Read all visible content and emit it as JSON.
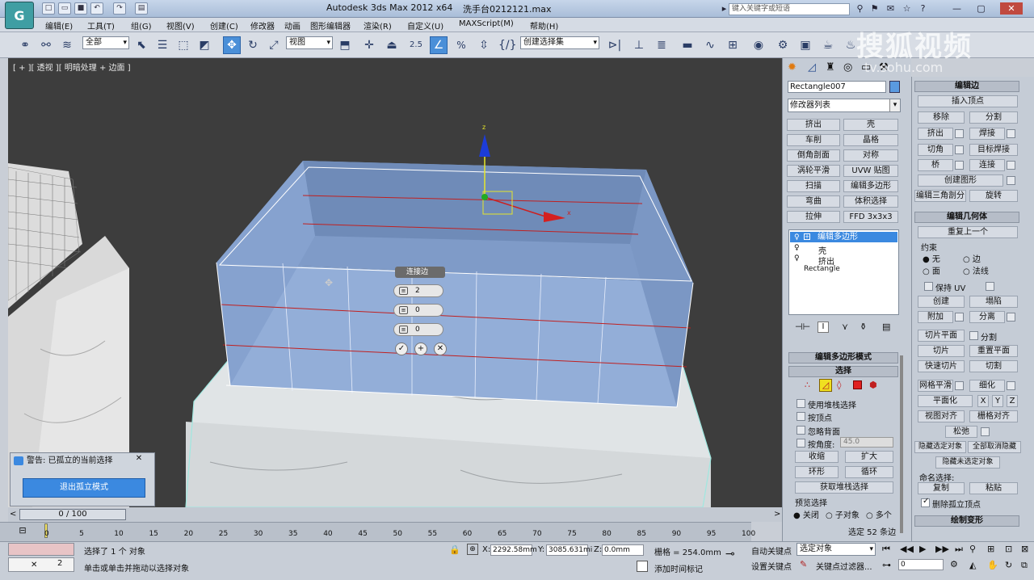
{
  "app": {
    "title": "Autodesk 3ds Max  2012 x64",
    "file": "洗手台0212121.max",
    "icon": "3ds-max-icon"
  },
  "search": {
    "placeholder": "键入关键字或短语"
  },
  "menu": [
    "编辑(E)",
    "工具(T)",
    "组(G)",
    "视图(V)",
    "创建(C)",
    "修改器",
    "动画",
    "图形编辑器",
    "渲染(R)",
    "自定义(U)",
    "MAXScript(M)",
    "帮助(H)"
  ],
  "toolbar": {
    "filter": "全部",
    "refcoord": "视图",
    "selset": "创建选择集",
    "snap": "2.5",
    "angle_snap": "%"
  },
  "viewport": {
    "label": "[ + ][ 透视 ][ 明暗处理 + 边面 ]",
    "axis_z": "z",
    "axis_x": "x"
  },
  "caddy": {
    "title": "连接边",
    "fields": [
      "2",
      "0",
      "0"
    ]
  },
  "isolate": {
    "title": "警告: 已孤立的当前选择",
    "button": "退出孤立模式"
  },
  "timeline": {
    "frame": "0 / 100",
    "ticks": [
      "0",
      "5",
      "10",
      "15",
      "20",
      "25",
      "30",
      "35",
      "40",
      "45",
      "50",
      "55",
      "60",
      "65",
      "70",
      "75",
      "80",
      "85",
      "90",
      "95",
      "100"
    ]
  },
  "status": {
    "selected": "选择了 1 个 对象",
    "hint": "单击或单击并拖动以选择对象",
    "x_label": "X:",
    "x": "2292.58mm",
    "y_label": "Y:",
    "y": "3085.631mi",
    "z_label": "Z:",
    "z": "0.0mm",
    "grid": "栅格 = 254.0mm",
    "autokey": "自动关键点",
    "setkey": "设置关键点",
    "keyfilter": "选定对象",
    "keyfilters": "关键点过滤器...",
    "addtime": "添加时间标记",
    "frame_val": "0",
    "mini_label": "2"
  },
  "cmd": {
    "object_name": "Rectangle007",
    "modlist": "修改器列表",
    "modbuttons": [
      "挤出",
      "壳",
      "车削",
      "晶格",
      "倒角剖面",
      "对称",
      "涡轮平滑",
      "UVW 贴图",
      "扫描",
      "编辑多边形",
      "弯曲",
      "体积选择",
      "拉伸",
      "FFD 3x3x3"
    ],
    "stack": [
      "编辑多边形",
      "壳",
      "挤出",
      "Rectangle"
    ],
    "editpoly_mode": "编辑多边形模式",
    "selection": "选择",
    "use_stack": "使用堆栈选择",
    "by_vertex": "按顶点",
    "ignore_back": "忽略背面",
    "by_angle": "按角度:",
    "angle_val": "45.0",
    "shrink": "收缩",
    "grow": "扩大",
    "ring": "环形",
    "loop": "循环",
    "get_stack": "获取堆栈选择",
    "preview": "预览选择",
    "preview_opts": [
      "关闭",
      "子对象",
      "多个"
    ],
    "selected_count": "选定 52 条边"
  },
  "rollout": {
    "edit_edges": "编辑边",
    "insert_vertex": "插入顶点",
    "remove": "移除",
    "split": "分割",
    "extrude": "挤出",
    "weld": "焊接",
    "chamfer": "切角",
    "target_weld": "目标焊接",
    "bridge": "桥",
    "connect": "连接",
    "create_shape": "创建图形",
    "edit_tri": "编辑三角剖分",
    "turn": "旋转",
    "edit_geo": "编辑几何体",
    "repeat": "重复上一个",
    "constraints": "约束",
    "c_opts": [
      "无",
      "边",
      "面",
      "法线"
    ],
    "preserve_uv": "保持 UV",
    "create": "创建",
    "collapse": "塌陷",
    "attach": "附加",
    "detach": "分离",
    "slice_plane": "切片平面",
    "split2": "分割",
    "slice": "切片",
    "reset_plane": "重置平面",
    "quickslice": "快速切片",
    "cut": "切割",
    "meshsmooth": "网格平滑",
    "tessellate": "细化",
    "planarize": "平面化",
    "xyz": [
      "X",
      "Y",
      "Z"
    ],
    "view_align": "视图对齐",
    "grid_align": "栅格对齐",
    "relax": "松弛",
    "hide_sel": "隐藏选定对象",
    "unhide_all": "全部取消隐藏",
    "hide_unsel": "隐藏未选定对象",
    "named_sel": "命名选择:",
    "copy": "复制",
    "paste": "粘贴",
    "del_iso": "删除孤立顶点",
    "paint_deform": "绘制变形"
  },
  "watermark": {
    "text": "搜狐视频",
    "url": "tv.sohu.com"
  },
  "colors": {
    "accent": "#3b89e0",
    "viewport_bg": "#3d3d3d",
    "mesh": "#93aed8"
  }
}
